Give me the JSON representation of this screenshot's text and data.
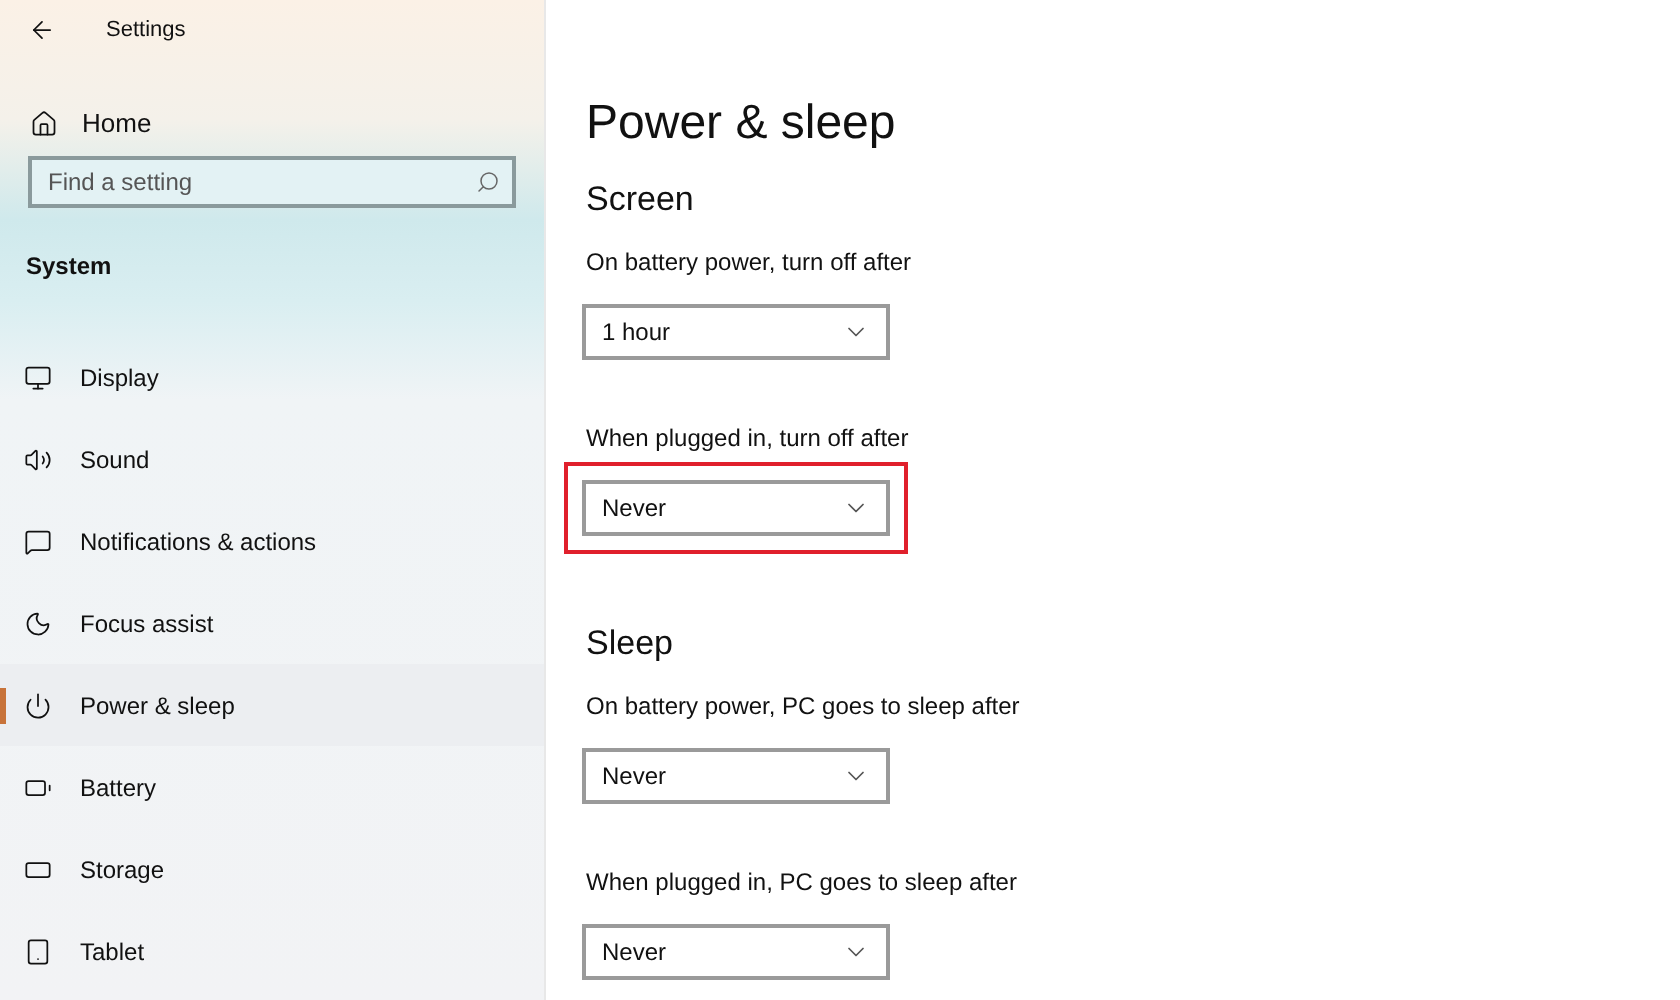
{
  "window": {
    "title": "Settings"
  },
  "sidebar": {
    "home": "Home",
    "search": {
      "placeholder": "Find a setting"
    },
    "section": "System",
    "items": [
      {
        "label": "Display",
        "selected": false
      },
      {
        "label": "Sound",
        "selected": false
      },
      {
        "label": "Notifications & actions",
        "selected": false
      },
      {
        "label": "Focus assist",
        "selected": false
      },
      {
        "label": "Power & sleep",
        "selected": true
      },
      {
        "label": "Battery",
        "selected": false
      },
      {
        "label": "Storage",
        "selected": false
      },
      {
        "label": "Tablet",
        "selected": false
      }
    ]
  },
  "page": {
    "title": "Power & sleep",
    "sections": [
      {
        "heading": "Screen",
        "settings": [
          {
            "label": "On battery power, turn off after",
            "value": "1 hour",
            "highlighted": false
          },
          {
            "label": "When plugged in, turn off after",
            "value": "Never",
            "highlighted": true
          }
        ]
      },
      {
        "heading": "Sleep",
        "settings": [
          {
            "label": "On battery power, PC goes to sleep after",
            "value": "Never",
            "highlighted": false
          },
          {
            "label": "When plugged in, PC goes to sleep after",
            "value": "Never",
            "highlighted": false
          }
        ]
      }
    ]
  }
}
